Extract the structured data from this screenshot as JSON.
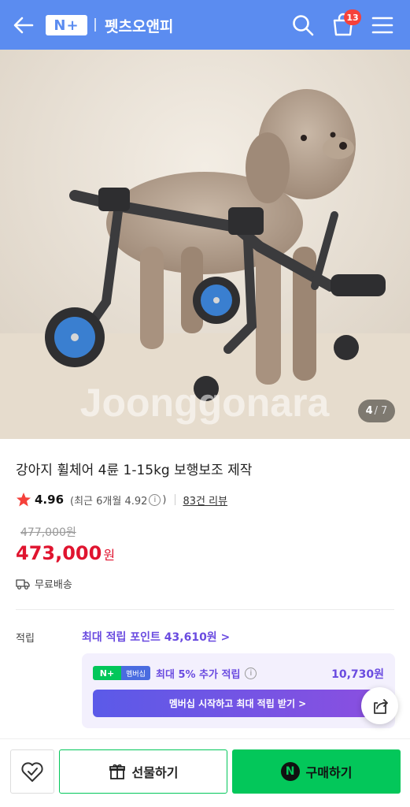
{
  "header": {
    "logo_text": "N+",
    "store_name": "펫츠오앤피",
    "cart_count": "13",
    "back_icon": "arrow-left-icon",
    "search_icon": "search-icon",
    "cart_icon": "shopping-bag-icon",
    "menu_icon": "hamburger-menu-icon",
    "bg_color": "#5b8cf0"
  },
  "gallery": {
    "current": "4",
    "total": "/ 7",
    "watermark": "Joonggonara"
  },
  "product": {
    "title": "강아지 휠체어 4륜 1-15kg 보행보조 제작",
    "rating": "4.96",
    "recent_rating_prefix": "(최근 6개월 4.92",
    "recent_rating_suffix": ")",
    "info_glyph": "i",
    "review_count": "83건 리뷰",
    "original_price": "477,000원",
    "price": "473,000",
    "price_unit": "원",
    "shipping": "무료배송",
    "price_color": "#e0142f"
  },
  "points": {
    "label": "적립",
    "max_points_link": "최대 적립 포인트 43,610원 >",
    "membership_logo_n": "N+",
    "membership_logo_label": "멤버십",
    "membership_text": "최대 5% 추가 적립",
    "membership_amount": "10,730원",
    "membership_button": "멤버십 시작하고 최대 적립 받기 >"
  },
  "bottom_bar": {
    "gift_label": "선물하기",
    "buy_label": "구매하기",
    "buy_badge": "N",
    "accent_color": "#03c75a"
  }
}
